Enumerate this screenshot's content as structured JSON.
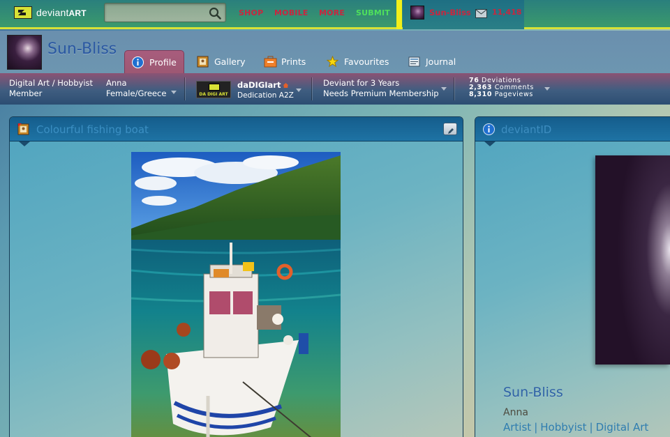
{
  "topbar": {
    "logo_prefix": "deviant",
    "logo_suffix": "ART",
    "search_value": "",
    "nav": [
      {
        "label": "SHOP"
      },
      {
        "label": "MOBILE"
      },
      {
        "label": "MORE"
      },
      {
        "label": "SUBMIT"
      }
    ],
    "username": "Sun-Bliss",
    "message_count": "11,418",
    "colors": {
      "accent_red": "#c8273f",
      "accent_green": "#4fe05b",
      "bar_yellow": "#f2ef1a"
    }
  },
  "profile": {
    "name": "Sun-Bliss",
    "tabs": [
      {
        "label": "Profile",
        "icon": "info-icon",
        "active": true
      },
      {
        "label": "Gallery",
        "icon": "gallery-icon",
        "active": false
      },
      {
        "label": "Prints",
        "icon": "prints-icon",
        "active": false
      },
      {
        "label": "Favourites",
        "icon": "star-icon",
        "active": false
      },
      {
        "label": "Journal",
        "icon": "journal-icon",
        "active": false
      }
    ]
  },
  "infobar": {
    "membership_line1": "Digital Art / Hobbyist",
    "membership_line2": "Member",
    "real_name": "Anna",
    "gender_location": "Female/Greece",
    "group_badge_text": "DA DIGI ART",
    "group_name": "daDIGIart",
    "group_role": "Dedication A2Z",
    "deviant_for": "Deviant for 3 Years",
    "premium_note": "Needs Premium Membership",
    "stats": [
      {
        "value": "76",
        "label": "Deviations"
      },
      {
        "value": "2,363",
        "label": "Comments"
      },
      {
        "value": "8,310",
        "label": "Pageviews"
      }
    ]
  },
  "left_panel": {
    "title": "Colourful fishing boat",
    "icon": "deviation-icon"
  },
  "right_panel": {
    "title": "deviantID",
    "icon": "info-icon",
    "username": "Sun-Bliss",
    "real_name": "Anna",
    "tags": [
      "Artist",
      "Hobbyist",
      "Digital Art"
    ]
  }
}
